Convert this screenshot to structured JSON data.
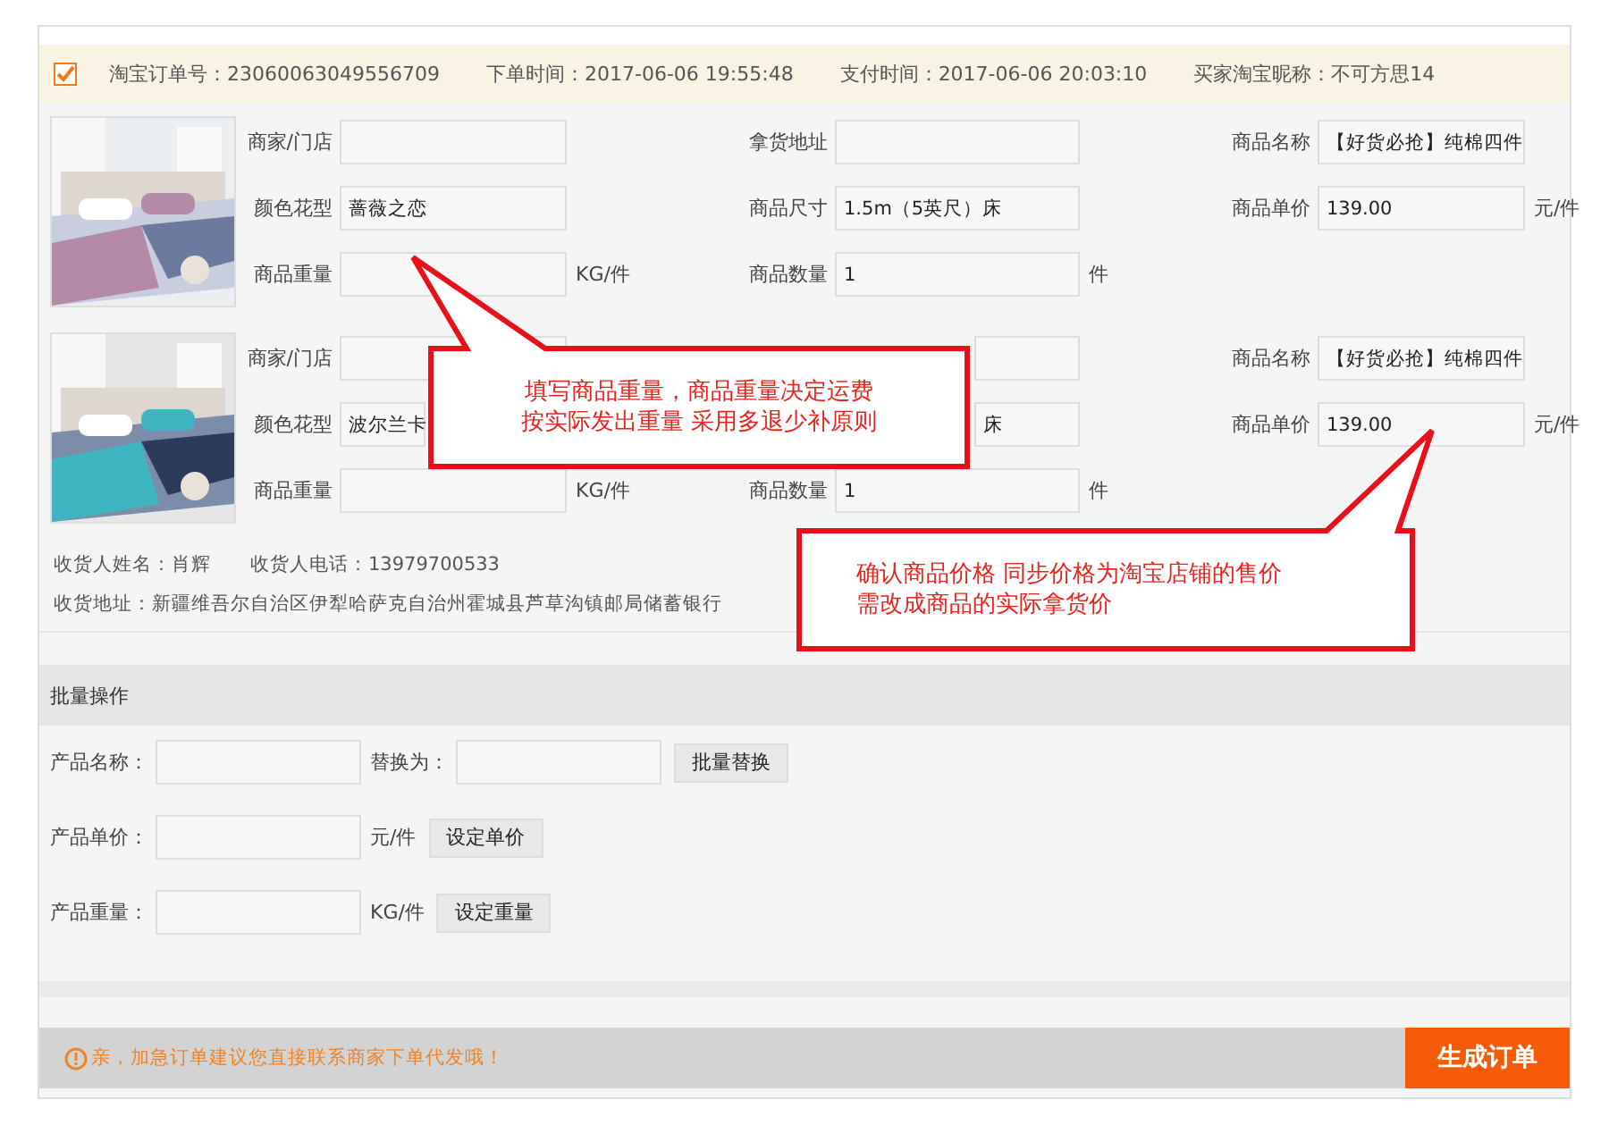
{
  "order": {
    "checked": true,
    "info": [
      "淘宝订单号：23060063049556709",
      "下单时间：2017-06-06 19:55:48",
      "支付时间：2017-06-06 20:03:10",
      "买家淘宝昵称：不可方思14"
    ]
  },
  "products": [
    {
      "rows": [
        [
          {
            "label": "商家/门店"
          },
          {
            "label": "拿货地址"
          },
          {
            "label": "商品名称",
            "value": "【好货必抢】纯棉四件"
          }
        ],
        [
          {
            "label": "颜色花型",
            "value": "蔷薇之恋"
          },
          {
            "label": "商品尺寸",
            "value": "1.5m（5英尺）床"
          },
          {
            "label": "商品单价",
            "value": "139.00",
            "unit": "元/件"
          }
        ],
        [
          {
            "label": "商品重量",
            "unit": "KG/件"
          },
          {
            "label": "商品数量",
            "value": "1",
            "unit": "件"
          }
        ]
      ]
    },
    {
      "rows": [
        [
          {
            "label": "商家/门店"
          },
          {
            "covered": true
          },
          {
            "label": "商品名称",
            "value": "【好货必抢】纯棉四件"
          }
        ],
        [
          {
            "label": "颜色花型",
            "value": "波尔兰卡",
            "covered": true
          },
          {
            "covered": true,
            "value": "床"
          },
          {
            "label": "商品单价",
            "value": "139.00",
            "unit": "元/件"
          }
        ],
        [
          {
            "label": "商品重量",
            "unit": "KG/件"
          },
          {
            "label": "商品数量",
            "value": "1",
            "unit": "件"
          }
        ]
      ]
    }
  ],
  "receiver": {
    "name": "收货人姓名：肖辉",
    "phone": "收货人电话：13979700533",
    "address": "收货地址：新疆维吾尔自治区伊犁哈萨克自治州霍城县芦草沟镇邮局储蓄银行"
  },
  "batch": {
    "title": "批量操作",
    "rows": [
      {
        "label": "产品名称：",
        "second_label": "替换为：",
        "button": "批量替换"
      },
      {
        "label": "产品单价：",
        "unit": "元/件",
        "button": "设定单价"
      },
      {
        "label": "产品重量：",
        "unit": "KG/件",
        "button": "设定重量"
      }
    ]
  },
  "footer": {
    "notice": "亲，加急订单建议您直接联系商家下单代发哦！",
    "button": "生成订单"
  },
  "callouts": [
    {
      "lines": [
        "填写商品重量，商品重量决定运费",
        "按实际发出重量 采用多退少补原则"
      ]
    },
    {
      "lines": [
        "确认商品价格 同步价格为淘宝店铺的售价",
        "需改成商品的实际拿货价"
      ]
    }
  ]
}
